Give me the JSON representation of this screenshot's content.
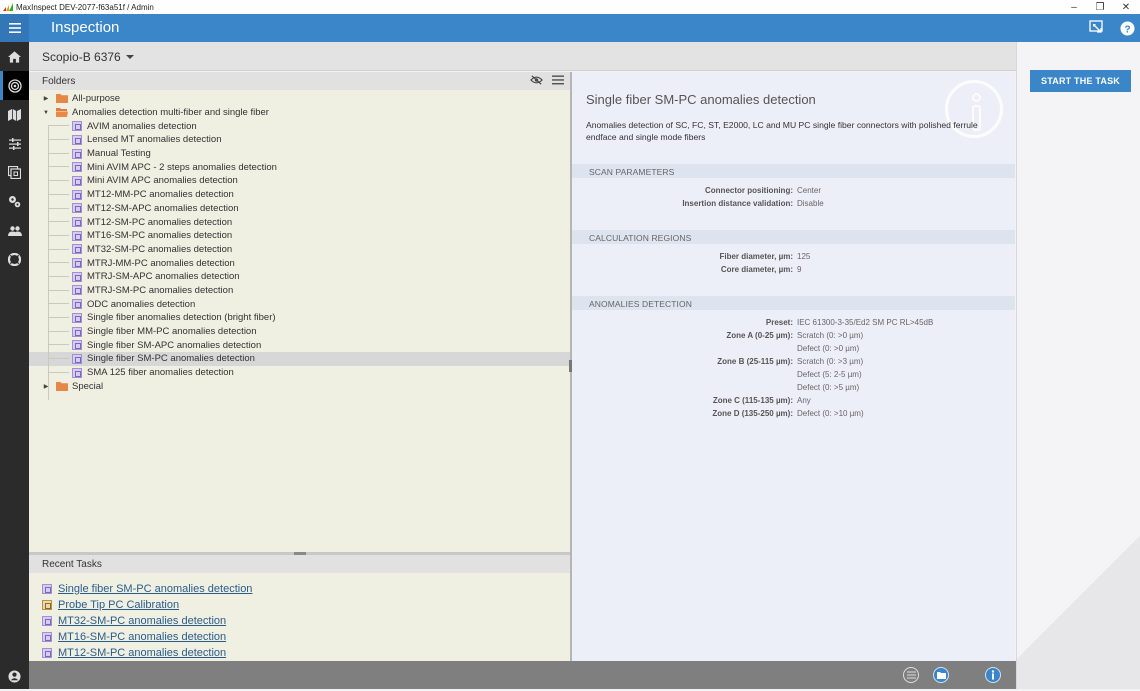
{
  "window": {
    "title": "MaxInspect DEV-2077-f63a51f / Admin",
    "controls": [
      "minimize",
      "restore",
      "close"
    ]
  },
  "header": {
    "title": "Inspection",
    "icons": [
      "menu-icon",
      "screen-capture-icon",
      "help-icon"
    ]
  },
  "nav": {
    "items": [
      {
        "name": "home",
        "icon": "home-icon",
        "active": false
      },
      {
        "name": "inspection",
        "icon": "target-icon",
        "active": true
      },
      {
        "name": "map",
        "icon": "map-icon",
        "active": false
      },
      {
        "name": "settings",
        "icon": "sliders-icon",
        "active": false
      },
      {
        "name": "gallery",
        "icon": "images-icon",
        "active": false
      },
      {
        "name": "configuration",
        "icon": "gears-icon",
        "active": false
      },
      {
        "name": "users",
        "icon": "users-icon",
        "active": false
      },
      {
        "name": "support",
        "icon": "lifebuoy-icon",
        "active": false
      }
    ],
    "account_icon": "user-account-icon"
  },
  "device": {
    "name": "Scopio-B 6376"
  },
  "folders": {
    "title": "Folders",
    "tree": [
      {
        "type": "folder",
        "label": "All-purpose",
        "expanded": false
      },
      {
        "type": "folder",
        "label": "Anomalies detection multi-fiber and single fiber",
        "expanded": true,
        "children": [
          "AVIM anomalies detection",
          "Lensed MT anomalies detection",
          "Manual Testing",
          "Mini AVIM APC - 2 steps anomalies detection",
          "Mini AVIM APC anomalies detection",
          "MT12-MM-PC anomalies detection",
          "MT12-SM-APC anomalies detection",
          "MT12-SM-PC anomalies detection",
          "MT16-SM-PC anomalies detection",
          "MT32-SM-PC anomalies detection",
          "MTRJ-MM-PC anomalies detection",
          "MTRJ-SM-APC anomalies detection",
          "MTRJ-SM-PC anomalies detection",
          "ODC anomalies detection",
          "Single fiber anomalies detection (bright fiber)",
          "Single fiber MM-PC anomalies detection",
          "Single fiber SM-APC anomalies detection",
          "Single fiber SM-PC anomalies detection",
          "SMA 125 fiber anomalies detection"
        ]
      },
      {
        "type": "folder",
        "label": "Special",
        "expanded": false
      }
    ],
    "selected": "Single fiber SM-PC anomalies detection"
  },
  "recent": {
    "title": "Recent Tasks",
    "items": [
      {
        "label": "Single fiber SM-PC anomalies detection",
        "kind": "detection"
      },
      {
        "label": "Probe Tip PC Calibration",
        "kind": "calibration"
      },
      {
        "label": "MT32-SM-PC anomalies detection",
        "kind": "detection"
      },
      {
        "label": "MT16-SM-PC anomalies detection",
        "kind": "detection"
      },
      {
        "label": "MT12-SM-PC anomalies detection",
        "kind": "detection"
      }
    ]
  },
  "details": {
    "title": "Single fiber SM-PC anomalies detection",
    "description": "Anomalies detection of SC, FC, ST, E2000, LC and MU PC single fiber connectors with polished ferrule endface and single mode fibers",
    "sections": [
      {
        "title": "SCAN PARAMETERS",
        "rows": [
          {
            "k": "Connector positioning:",
            "v": "Center"
          },
          {
            "k": "Insertion distance validation:",
            "v": "Disable"
          }
        ]
      },
      {
        "title": "CALCULATION REGIONS",
        "rows": [
          {
            "k": "Fiber diameter, µm:",
            "v": "125"
          },
          {
            "k": "Core diameter, µm:",
            "v": "9"
          }
        ]
      },
      {
        "title": "ANOMALIES DETECTION",
        "rows": [
          {
            "k": "Preset:",
            "v": "IEC 61300-3-35/Ed2 SM PC RL>45dB"
          },
          {
            "k": "Zone A (0-25 µm):",
            "v": "Scratch (0: >0 µm)"
          },
          {
            "k": "",
            "v": "Defect (0: >0 µm)"
          },
          {
            "k": "Zone B (25-115 µm):",
            "v": "Scratch (0: >3 µm)"
          },
          {
            "k": "",
            "v": "Defect (5: 2-5 µm)"
          },
          {
            "k": "",
            "v": "Defect (0: >5 µm)"
          },
          {
            "k": "Zone C (115-135 µm):",
            "v": "Any"
          },
          {
            "k": "Zone D (135-250 µm):",
            "v": "Defect (0: >10 µm)"
          }
        ]
      }
    ]
  },
  "actions": {
    "start_label": "START THE TASK"
  },
  "statusbar": {
    "icons": [
      "list-icon",
      "folder-icon",
      "info-icon"
    ]
  },
  "colors": {
    "accent": "#3b86c8",
    "nav_bg": "#2b2b2b",
    "panel_bg": "#efefe2",
    "details_bg": "#eceff8",
    "link": "#2c5c8a"
  }
}
